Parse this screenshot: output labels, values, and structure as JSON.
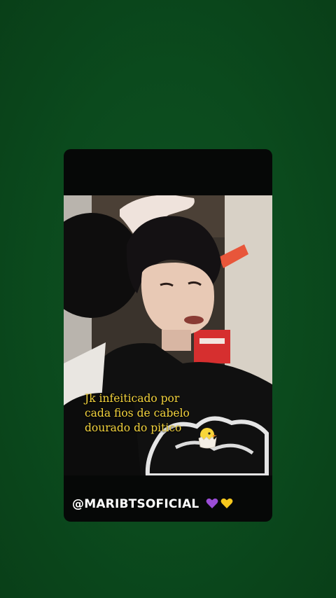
{
  "post": {
    "caption_lines": [
      "Jk infeiticado por",
      "cada fios de cabelo",
      "dourado do pitico"
    ],
    "chick_icon": "hatching-chick-icon",
    "handle": "@MARIBTSOFICIAL",
    "heart_icons": [
      "purple-heart-icon",
      "yellow-heart-icon"
    ]
  },
  "colors": {
    "background": "#0b4a1d",
    "caption": "#f2d23c",
    "handle": "#ffffff",
    "purple_heart": "#9b4dd6",
    "yellow_heart": "#f7c81d"
  }
}
